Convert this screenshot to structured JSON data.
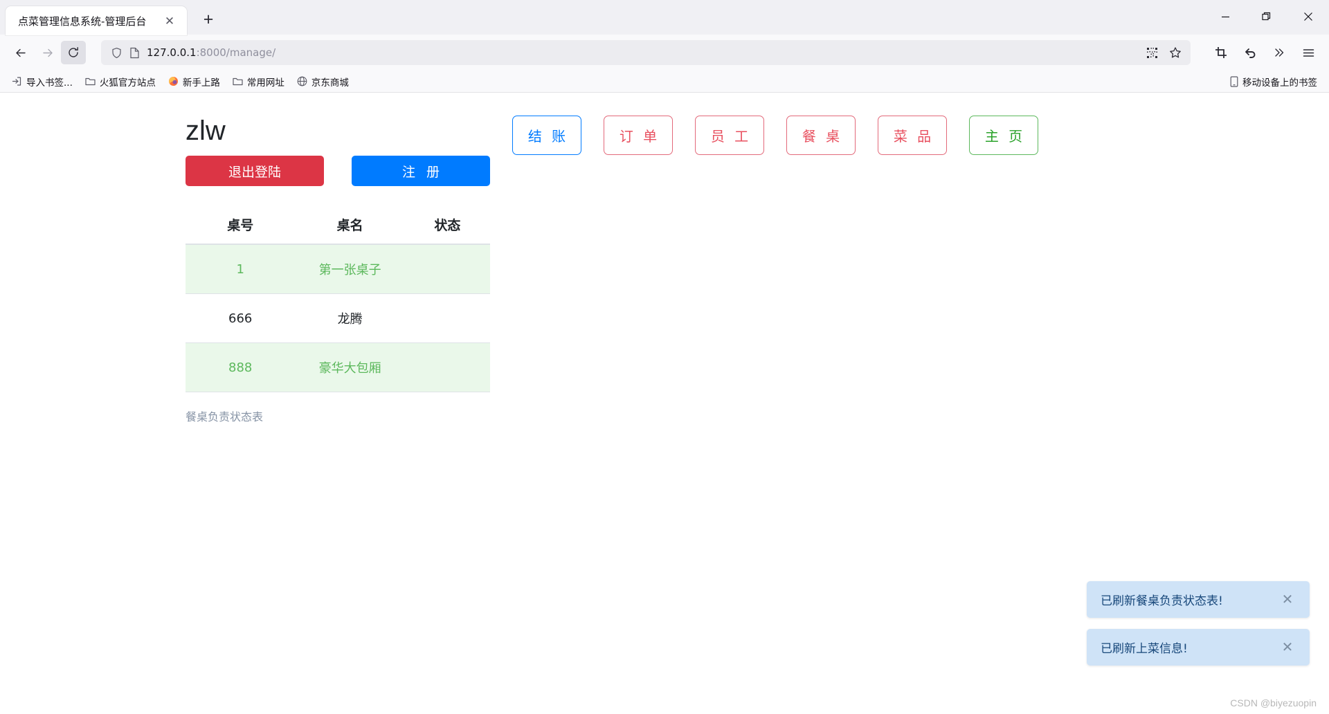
{
  "browser": {
    "tab": {
      "title": "点菜管理信息系统-管理后台",
      "close_label": "✕"
    },
    "new_tab_label": "+",
    "window_controls": {
      "minimize": "—",
      "maximize": "❐",
      "close": "✕"
    },
    "nav": {
      "back": "←",
      "forward": "→",
      "reload": "⟳"
    },
    "address": {
      "host": "127.0.0.1",
      "rest": ":8000/manage/",
      "shield_icon": "shield-icon",
      "page_icon": "page-icon",
      "qr_icon": "qr-code-icon",
      "star_icon": "bookmark-star-icon"
    },
    "toolbar_right": {
      "screenshot_icon": "crop-screenshot-icon",
      "undo_icon": "undo-arrow-icon",
      "overflow_icon": "chevron-double-right-icon",
      "menu_icon": "hamburger-menu-icon"
    },
    "bookmarks": [
      {
        "label": "导入书签...",
        "icon": "import-bookmarks-icon"
      },
      {
        "label": "火狐官方站点",
        "icon": "folder-icon"
      },
      {
        "label": "新手上路",
        "icon": "firefox-icon"
      },
      {
        "label": "常用网址",
        "icon": "folder-icon"
      },
      {
        "label": "京东商城",
        "icon": "globe-icon"
      }
    ],
    "bookmarks_right": {
      "label": "移动设备上的书签",
      "icon": "mobile-device-icon"
    }
  },
  "app": {
    "brand": "zlw",
    "logout_label": "退出登陆",
    "register_label": "注 册",
    "nav_buttons": [
      {
        "label": "结 账",
        "style": "blue"
      },
      {
        "label": "订 单",
        "style": "red"
      },
      {
        "label": "员 工",
        "style": "red"
      },
      {
        "label": "餐 桌",
        "style": "red"
      },
      {
        "label": "菜 品",
        "style": "red"
      },
      {
        "label": "主 页",
        "style": "green"
      }
    ],
    "table": {
      "caption": "餐桌负责状态表",
      "headers": [
        "桌号",
        "桌名",
        "状态"
      ],
      "rows": [
        {
          "num": "1",
          "name": "第一张桌子",
          "status": "",
          "state": "free"
        },
        {
          "num": "666",
          "name": "龙腾",
          "status": "",
          "state": "busy"
        },
        {
          "num": "888",
          "name": "豪华大包厢",
          "status": "",
          "state": "free"
        }
      ]
    },
    "toasts": [
      {
        "message": "已刷新餐桌负责状态表!",
        "close": "✕"
      },
      {
        "message": "已刷新上菜信息!",
        "close": "✕"
      }
    ],
    "watermark": "CSDN @biyezuopin"
  },
  "colors": {
    "logout": "#dc3545",
    "register": "#007bff",
    "row_free_bg": "#eaf8ea",
    "row_free_text": "#5cb85c",
    "toast_bg": "#cfe3f7",
    "toast_text": "#17477a"
  }
}
